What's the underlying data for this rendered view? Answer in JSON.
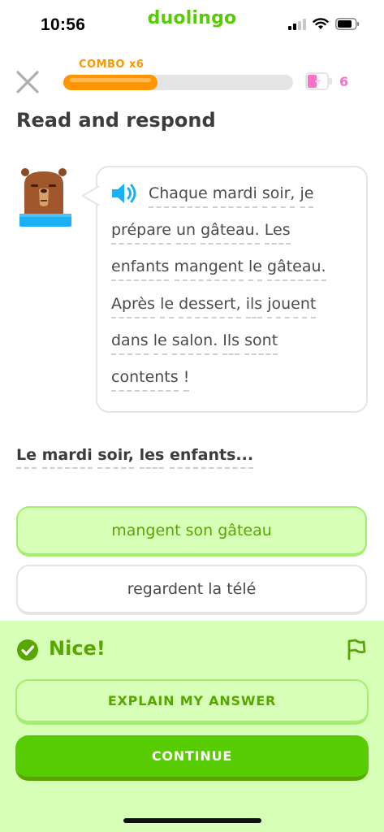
{
  "status_bar": {
    "time": "10:56",
    "app_name": "duolingo",
    "icons": [
      "signal-icon",
      "wifi-icon",
      "battery-icon"
    ]
  },
  "header": {
    "combo_label": "COMBO x6",
    "progress": 0.41,
    "energy_count": "6",
    "colors": {
      "progress": "#ff9600",
      "energy": "#ff6ec7"
    }
  },
  "prompt": {
    "title": "Read and respond"
  },
  "passage": {
    "lines": [
      [
        "Chaque",
        "mardi",
        "soir,",
        "je"
      ],
      [
        "prépare",
        "un",
        "gâteau.",
        "Les"
      ],
      [
        "enfants",
        "mangent",
        "le",
        "gâteau."
      ],
      [
        "Après",
        "le",
        "dessert,",
        "ils",
        "jouent"
      ],
      [
        "dans",
        "le",
        "salon.",
        "Ils",
        "sont"
      ],
      [
        "contents",
        "!"
      ]
    ]
  },
  "question": {
    "words": [
      "Le",
      "mardi",
      "soir,",
      "les",
      "enfants..."
    ]
  },
  "choices": [
    {
      "label": "mangent son gâteau",
      "state": "correct"
    },
    {
      "label": "regardent la télé",
      "state": "default"
    }
  ],
  "feedback": {
    "title": "Nice!",
    "explain_label": "EXPLAIN MY ANSWER",
    "continue_label": "CONTINUE",
    "colors": {
      "background": "#d7ffb8",
      "accent": "#58a700",
      "button": "#58cc02"
    }
  }
}
